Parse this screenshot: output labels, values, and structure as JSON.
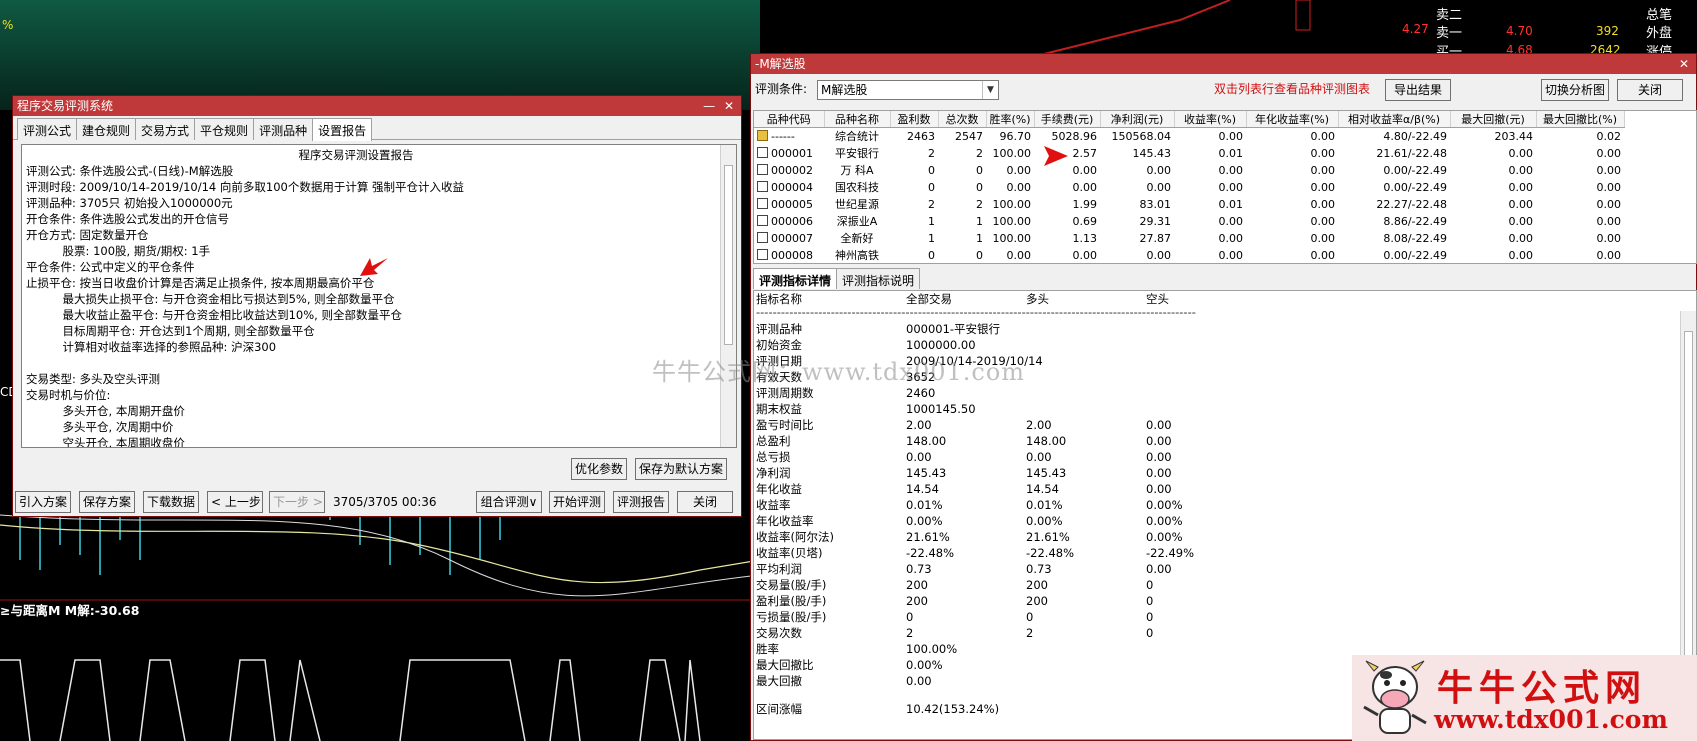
{
  "background": {
    "label_top_left": "%",
    "label_cd": "CD",
    "indicator_label": "≥与距离M M解:-30.68",
    "quote_panel": {
      "rows": [
        {
          "label": "卖二",
          "price": "",
          "vol": "",
          "extra": "总笔"
        },
        {
          "label": "卖一",
          "price": "4.70",
          "vol": "392",
          "extra": "外盘"
        },
        {
          "label": "买一",
          "price": "4.68",
          "vol": "2642",
          "extra": "涨停"
        }
      ],
      "price_left": "4.27"
    }
  },
  "left_window": {
    "title": "程序交易评测系统",
    "tabs": [
      "评测公式",
      "建仓规则",
      "交易方式",
      "平仓规则",
      "评测品种",
      "设置报告"
    ],
    "active_tab": "设置报告",
    "report_title": "程序交易评测设置报告",
    "report_lines": [
      "评测公式: 条件选股公式-(日线)-M解选股",
      "评测时段: 2009/10/14-2019/10/14 向前多取100个数据用于计算 强制平仓计入收益",
      "评测品种: 3705只 初始投入1000000元",
      "开仓条件: 条件选股公式发出的开仓信号",
      "开仓方式: 固定数量开仓",
      "          股票: 100股, 期货/期权: 1手",
      "平仓条件: 公式中定义的平仓条件",
      "止损平仓: 按当日收盘价计算是否满足止损条件, 按本周期最高价平仓",
      "          最大损失止损平仓: 与开仓资金相比亏损达到5%, 则全部数量平仓",
      "          最大收益止盈平仓: 与开仓资金相比收益达到10%, 则全部数量平仓",
      "          目标周期平仓: 开仓达到1个周期, 则全部数量平仓",
      "          计算相对收益率选择的参照品种: 沪深300",
      "",
      "交易类型: 多头及空头评测",
      "交易时机与价位:",
      "          多头开仓, 本周期开盘价",
      "          多头平仓, 次周期中价",
      "          空头开仓, 本周期收盘价"
    ],
    "btn_optimize": "优化参数",
    "btn_save_default": "保存为默认方案",
    "btn_import": "引入方案",
    "btn_save": "保存方案",
    "btn_download": "下载数据",
    "btn_prev": "< 上一步",
    "btn_next": "下一步 >",
    "progress_text": "3705/3705  00:36",
    "btn_combo": "组合评测∨",
    "btn_start": "开始评测",
    "btn_report": "评测报告",
    "btn_close": "关闭"
  },
  "right_window": {
    "title": "-M解选股",
    "condition_label": "评测条件:",
    "condition_value": "M解选股",
    "hint": "双击列表行查看品种评测图表",
    "btn_export": "导出结果",
    "btn_switch": "切换分析图",
    "btn_close": "关闭",
    "columns": [
      "品种代码",
      "品种名称",
      "盈利数",
      "总次数",
      "胜率(%)",
      "手续费(元)",
      "净利润(元)",
      "收益率(%)",
      "年化收益率(%)",
      "相对收益率α/β(%)",
      "最大回撤(元)",
      "最大回撤比(%)"
    ],
    "rows": [
      [
        "------",
        "综合统计",
        "2463",
        "2547",
        "96.70",
        "5028.96",
        "150568.04",
        "0.00",
        "0.00",
        "4.80/-22.49",
        "203.44",
        "0.02"
      ],
      [
        "000001",
        "平安银行",
        "2",
        "2",
        "100.00",
        "2.57",
        "145.43",
        "0.01",
        "0.00",
        "21.61/-22.48",
        "0.00",
        "0.00"
      ],
      [
        "000002",
        "万 科A",
        "0",
        "0",
        "0.00",
        "0.00",
        "0.00",
        "0.00",
        "0.00",
        "0.00/-22.49",
        "0.00",
        "0.00"
      ],
      [
        "000004",
        "国农科技",
        "0",
        "0",
        "0.00",
        "0.00",
        "0.00",
        "0.00",
        "0.00",
        "0.00/-22.49",
        "0.00",
        "0.00"
      ],
      [
        "000005",
        "世纪星源",
        "2",
        "2",
        "100.00",
        "1.99",
        "83.01",
        "0.01",
        "0.00",
        "22.27/-22.48",
        "0.00",
        "0.00"
      ],
      [
        "000006",
        "深振业A",
        "1",
        "1",
        "100.00",
        "0.69",
        "29.31",
        "0.00",
        "0.00",
        "8.86/-22.49",
        "0.00",
        "0.00"
      ],
      [
        "000007",
        "全新好",
        "1",
        "1",
        "100.00",
        "1.13",
        "27.87",
        "0.00",
        "0.00",
        "8.08/-22.49",
        "0.00",
        "0.00"
      ],
      [
        "000008",
        "神州高铁",
        "0",
        "0",
        "0.00",
        "0.00",
        "0.00",
        "0.00",
        "0.00",
        "0.00/-22.49",
        "0.00",
        "0.00"
      ]
    ],
    "detail_tabs": [
      "评测指标详情",
      "评测指标说明"
    ],
    "detail_header": [
      "指标名称",
      "全部交易",
      "多头",
      "空头"
    ],
    "detail_separator": "----------------------------------------------------------------------------------------------------------",
    "detail_rows": [
      [
        "评测品种",
        "000001-平安银行",
        "",
        ""
      ],
      [
        "初始资金",
        "1000000.00",
        "",
        ""
      ],
      [
        "评测日期",
        "2009/10/14-2019/10/14",
        "",
        ""
      ],
      [
        "有效天数",
        "3652",
        "",
        ""
      ],
      [
        "评测周期数",
        "2460",
        "",
        ""
      ],
      [
        "期末权益",
        "1000145.50",
        "",
        ""
      ],
      [
        "盈亏时间比",
        "2.00",
        "2.00",
        "0.00"
      ],
      [
        "总盈利",
        "148.00",
        "148.00",
        "0.00"
      ],
      [
        "总亏损",
        "0.00",
        "0.00",
        "0.00"
      ],
      [
        "净利润",
        "145.43",
        "145.43",
        "0.00"
      ],
      [
        "年化收益",
        "14.54",
        "14.54",
        "0.00"
      ],
      [
        "收益率",
        "0.01%",
        "0.01%",
        "0.00%"
      ],
      [
        "年化收益率",
        "0.00%",
        "0.00%",
        "0.00%"
      ],
      [
        "收益率(阿尔法)",
        "21.61%",
        "21.61%",
        "0.00%"
      ],
      [
        "收益率(贝塔)",
        "-22.48%",
        "-22.48%",
        "-22.49%"
      ],
      [
        "平均利润",
        "0.73",
        "0.73",
        "0.00"
      ],
      [
        "交易量(股/手)",
        "200",
        "200",
        "0"
      ],
      [
        "盈利量(股/手)",
        "200",
        "200",
        "0"
      ],
      [
        "亏损量(股/手)",
        "0",
        "0",
        "0"
      ],
      [
        "交易次数",
        "2",
        "2",
        "0"
      ],
      [
        "胜率",
        "100.00%",
        "",
        ""
      ],
      [
        "最大回撤比",
        "0.00%",
        "",
        ""
      ],
      [
        "最大回撤",
        "0.00",
        "",
        ""
      ],
      [
        "",
        "",
        "",
        ""
      ],
      [
        "区间涨幅",
        "10.42(153.24%)",
        "",
        ""
      ]
    ]
  },
  "watermark": "牛牛公式网：www.tdx001.com",
  "logo": {
    "name": "牛牛公式网",
    "url": "www.tdx001.com"
  },
  "colors": {
    "title_bar": "#c0393a",
    "hint_red": "#d01010",
    "chart_bg": "#000000",
    "chart_green_bg": "#0d3b2e"
  }
}
